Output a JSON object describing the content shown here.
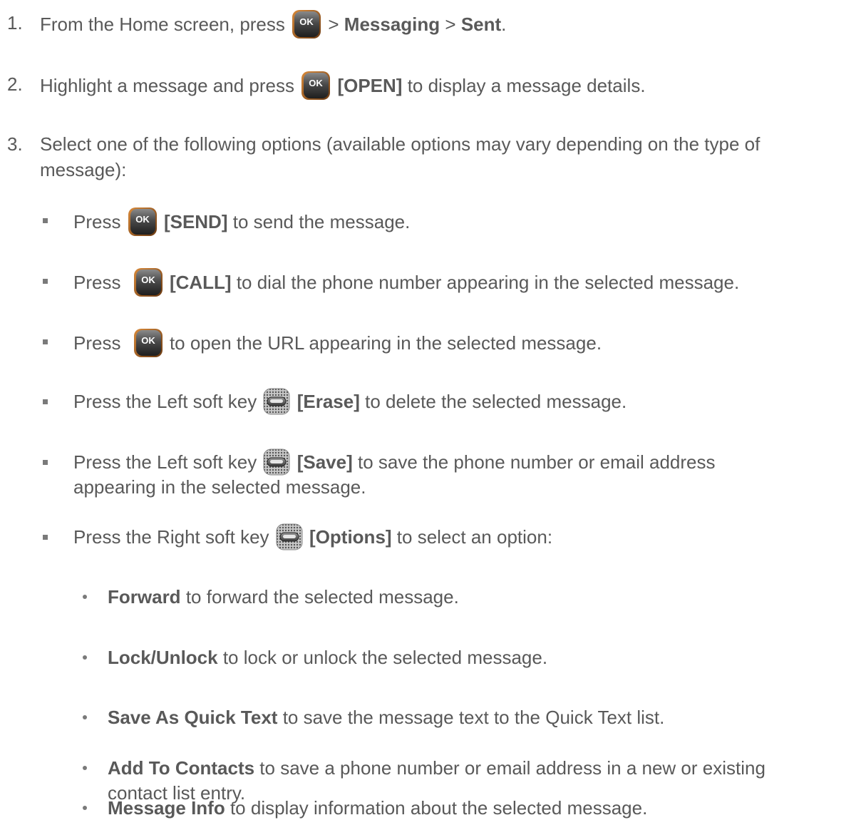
{
  "steps": [
    {
      "number": "1.",
      "a": "From the Home screen, press",
      "b": ">",
      "c": "Messaging",
      "d": ">",
      "e": "Sent",
      "f": "."
    },
    {
      "number": "2.",
      "a": "Highlight a message and press",
      "b": "[OPEN]",
      "c": "to display a message details."
    },
    {
      "number": "3.",
      "line1": "Select one of the following options (available options may vary depending on the type of",
      "line2": "message):"
    }
  ],
  "options": [
    {
      "a": "Press",
      "b": "[SEND]",
      "c": "to send the message."
    },
    {
      "a": "Press",
      "b": "[CALL]",
      "c": "to dial the phone number appearing in the selected message."
    },
    {
      "a": "Press",
      "c": "to open the URL appearing in the selected message."
    },
    {
      "a": "Press the Left soft key",
      "b": "[Erase]",
      "c": "to delete the selected message."
    },
    {
      "a": "Press the Left soft key",
      "b": "[Save]",
      "c": "to save the phone number or email address",
      "d": "appearing in the selected message."
    },
    {
      "a": "Press the Right soft key",
      "b": "[Options]",
      "c": "to select an option:"
    }
  ],
  "sub_options": [
    {
      "term": "Forward",
      "desc": "to forward the selected message."
    },
    {
      "term": "Lock/Unlock",
      "desc": "to lock or unlock the selected message."
    },
    {
      "term": "Save As Quick Text",
      "desc": "to save the message text to the Quick Text list."
    },
    {
      "term": "Add To Contacts",
      "desc": "to save a phone number or email address in a new or existing",
      "desc2": "contact list entry."
    },
    {
      "term": "Message Info",
      "desc": "to display information about the selected message."
    }
  ],
  "icons": {
    "ok_key": "ok-key-icon",
    "ok_label": "OK",
    "soft_key": "soft-key-icon"
  }
}
